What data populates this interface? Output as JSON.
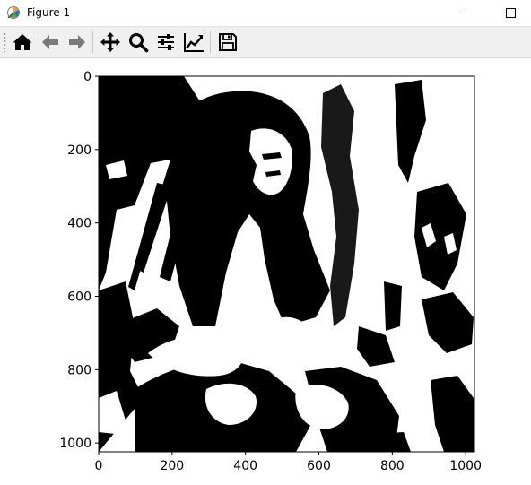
{
  "window": {
    "title": "Figure 1",
    "icon": "matplotlib-figure-icon",
    "controls": [
      "minimize-icon",
      "maximize-icon"
    ]
  },
  "toolbar": {
    "tools": [
      {
        "name": "home",
        "icon": "home-icon"
      },
      {
        "name": "back",
        "icon": "back-arrow-icon"
      },
      {
        "name": "forward",
        "icon": "forward-arrow-icon"
      },
      {
        "name": "pan",
        "icon": "pan-move-icon"
      },
      {
        "name": "zoom",
        "icon": "zoom-magnifier-icon"
      },
      {
        "name": "subplots",
        "icon": "configure-subplots-icon"
      },
      {
        "name": "customize",
        "icon": "edit-axis-line-icon"
      },
      {
        "name": "save",
        "icon": "save-disk-icon"
      }
    ]
  },
  "figure": {
    "image_content": "black-and-white binarized photograph",
    "colors": {
      "foreground": "#000000",
      "background": "#ffffff"
    },
    "x_ticks": [
      "0",
      "200",
      "400",
      "600",
      "800",
      "1000"
    ],
    "y_ticks": [
      "0",
      "200",
      "400",
      "600",
      "800",
      "1000"
    ],
    "x_range": [
      0,
      1024
    ],
    "y_range": [
      1024,
      0
    ]
  }
}
